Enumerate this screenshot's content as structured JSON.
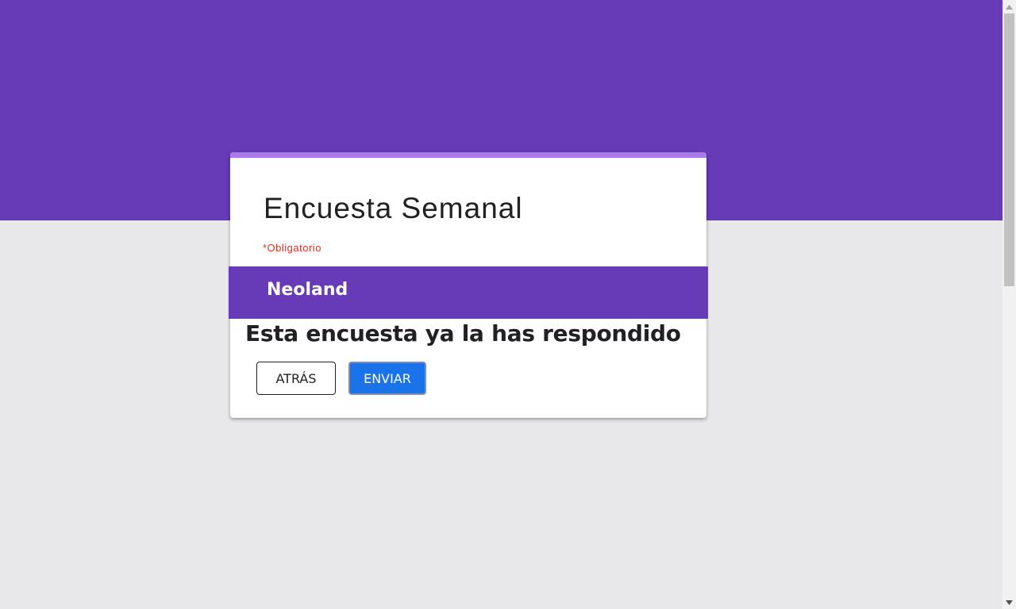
{
  "form": {
    "title": "Encuesta Semanal",
    "required_note": "*Obligatorio"
  },
  "section": {
    "title": "Neoland"
  },
  "message": "Esta encuesta ya la has respondido",
  "buttons": {
    "back_label": "ATRÁS",
    "send_label": "ENVIAR"
  },
  "colors": {
    "header_purple": "#673ab7",
    "accent": "#a97be8",
    "required_red": "#d93025",
    "send_blue": "#1a73e8",
    "background": "#e8e7ea"
  },
  "icons": {
    "scroll_up": "triangle-up-icon",
    "scroll_down": "triangle-down-icon"
  }
}
